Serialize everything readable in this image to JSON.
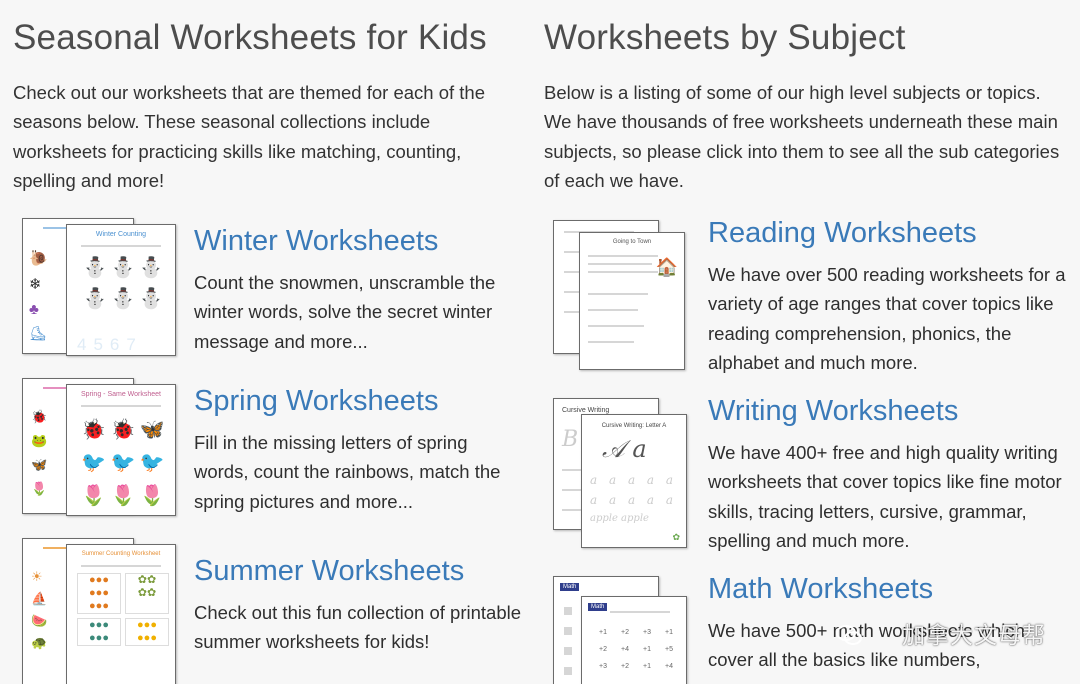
{
  "left": {
    "title": "Seasonal Worksheets for Kids",
    "intro": "Check out our worksheets that are themed for each of the seasons below. These seasonal collections include worksheets for practicing skills like matching, counting, spelling and more!",
    "cards": [
      {
        "title": "Winter Worksheets",
        "desc": "Count the snowmen, unscramble the winter words, solve the secret winter message and more...",
        "thumb_label": "Winter Counting"
      },
      {
        "title": "Spring Worksheets",
        "desc": "Fill in the missing letters of spring words, count the rainbows, match the spring pictures and more...",
        "thumb_label": "Spring - Same Worksheet"
      },
      {
        "title": "Summer Worksheets",
        "desc": "Check out this fun collection of printable summer worksheets for kids!",
        "thumb_label": "Summer Counting Worksheet"
      }
    ]
  },
  "right": {
    "title": "Worksheets by Subject",
    "intro": "Below is a listing of some of our high level subjects or topics. We have thousands of free worksheets underneath these main subjects, so please click into them to see all the sub categories of each we have.",
    "cards": [
      {
        "title": "Reading Worksheets",
        "desc": "We have over 500 reading worksheets for a variety of age ranges that cover topics like reading comprehension, phonics, the alphabet and much more.",
        "thumb_label": "Going to Town"
      },
      {
        "title": "Writing Worksheets",
        "desc": "We have 400+ free and high quality writing worksheets that cover topics like fine motor skills, tracing letters, cursive, grammar, spelling and much more.",
        "thumb_label": "Cursive Writing: Letter A"
      },
      {
        "title": "Math Worksheets",
        "desc": "We have 500+ math worksheets which cover all the basics like numbers,",
        "thumb_label": "Math"
      }
    ]
  },
  "watermark": "加拿大文母帮",
  "colors": {
    "link": "#3a7ab8",
    "heading": "#4d4d4d",
    "background": "#f7f7f7"
  }
}
